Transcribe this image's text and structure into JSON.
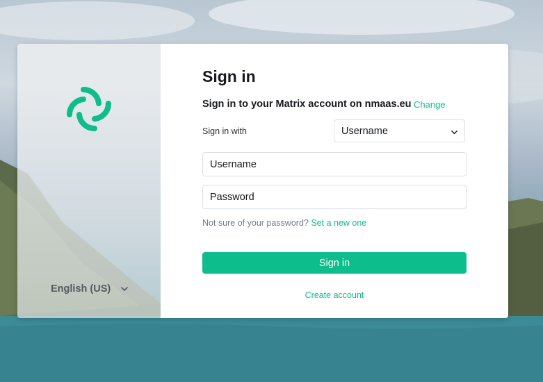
{
  "colors": {
    "accent": "#0dbd8b",
    "text_primary": "#17191c",
    "text_secondary": "#737d8c",
    "panel_bg": "#ffffff"
  },
  "sidebar": {
    "logo_icon": "element-logo-icon",
    "language_label": "English (US)",
    "language_chevron_icon": "chevron-down-icon"
  },
  "login": {
    "title": "Sign in",
    "subtitle": "Sign in to your Matrix account on nmaas.eu",
    "change_link": "Change",
    "sign_in_with_label": "Sign in with",
    "sign_in_with_value": "Username",
    "username_placeholder": "Username",
    "password_placeholder": "Password",
    "forgot_text": "Not sure of your password?",
    "forgot_link": "Set a new one",
    "submit_label": "Sign in",
    "create_account_label": "Create account"
  }
}
